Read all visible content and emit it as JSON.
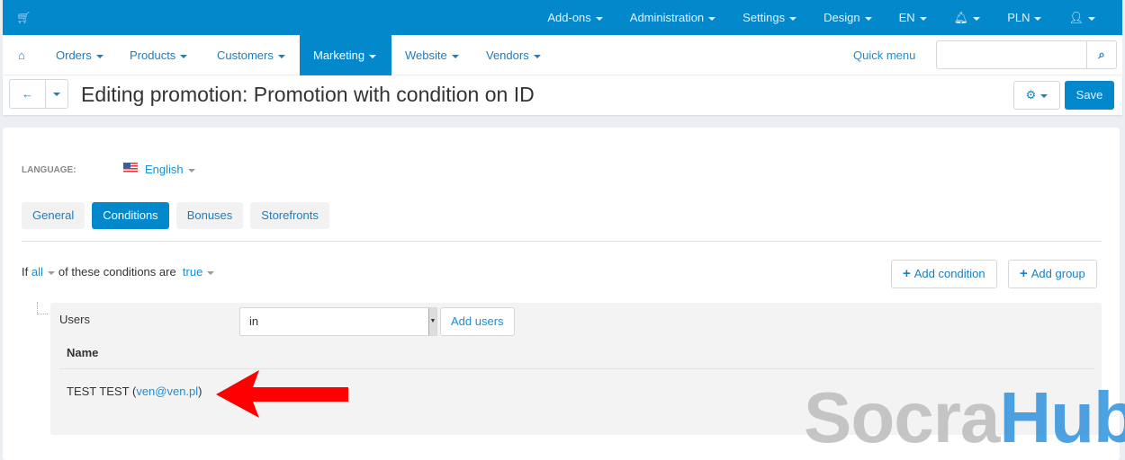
{
  "topbar": {
    "items": [
      "Add-ons",
      "Administration",
      "Settings",
      "Design",
      "EN",
      "",
      "PLN",
      ""
    ]
  },
  "nav": {
    "items": [
      "Orders",
      "Products",
      "Customers",
      "Marketing",
      "Website",
      "Vendors"
    ],
    "active": "Marketing",
    "quick_menu": "Quick menu",
    "search_placeholder": ""
  },
  "titlebar": {
    "title": "Editing promotion: Promotion with condition on ID",
    "save": "Save"
  },
  "language": {
    "label": "LANGUAGE:",
    "value": "English"
  },
  "tabs": [
    "General",
    "Conditions",
    "Bonuses",
    "Storefronts"
  ],
  "conditions": {
    "if": "If",
    "all": "all",
    "middle": "of these conditions are",
    "true": "true",
    "add_condition": "Add condition",
    "add_group": "Add group"
  },
  "group": {
    "label": "Users",
    "operator": "in",
    "add_users": "Add users",
    "column": "Name",
    "rows": [
      {
        "name": "TEST TEST",
        "email": "ven@ven.pl"
      }
    ]
  },
  "watermark": {
    "part1": "Socra",
    "part2": "Hub"
  },
  "colors": {
    "primary": "#0388cc",
    "arrow": "#ff0000"
  }
}
